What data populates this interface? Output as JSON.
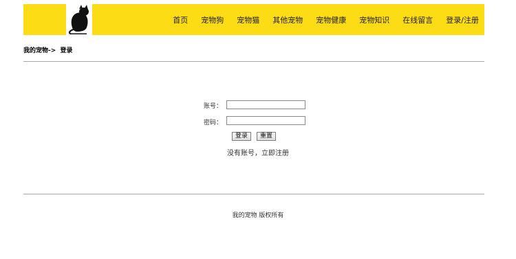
{
  "header": {
    "logo_icon": "black-cat-icon",
    "accent_color": "#FCDC14",
    "nav": [
      {
        "label": "首页"
      },
      {
        "label": "宠物狗"
      },
      {
        "label": "宠物猫"
      },
      {
        "label": "其他宠物"
      },
      {
        "label": "宠物健康"
      },
      {
        "label": "宠物知识"
      },
      {
        "label": "在线留言"
      },
      {
        "label": "登录/注册"
      }
    ]
  },
  "breadcrumb": {
    "home": "我的宠物",
    "separator": "->",
    "current": "登录"
  },
  "login": {
    "account_label": "账号：",
    "account_value": "",
    "password_label": "密码：",
    "password_value": "",
    "login_button": "登录",
    "reset_button": "重置",
    "no_account_text": "没有账号，",
    "register_link": "立即注册"
  },
  "footer": {
    "copyright": "我的宠物  版权所有"
  }
}
